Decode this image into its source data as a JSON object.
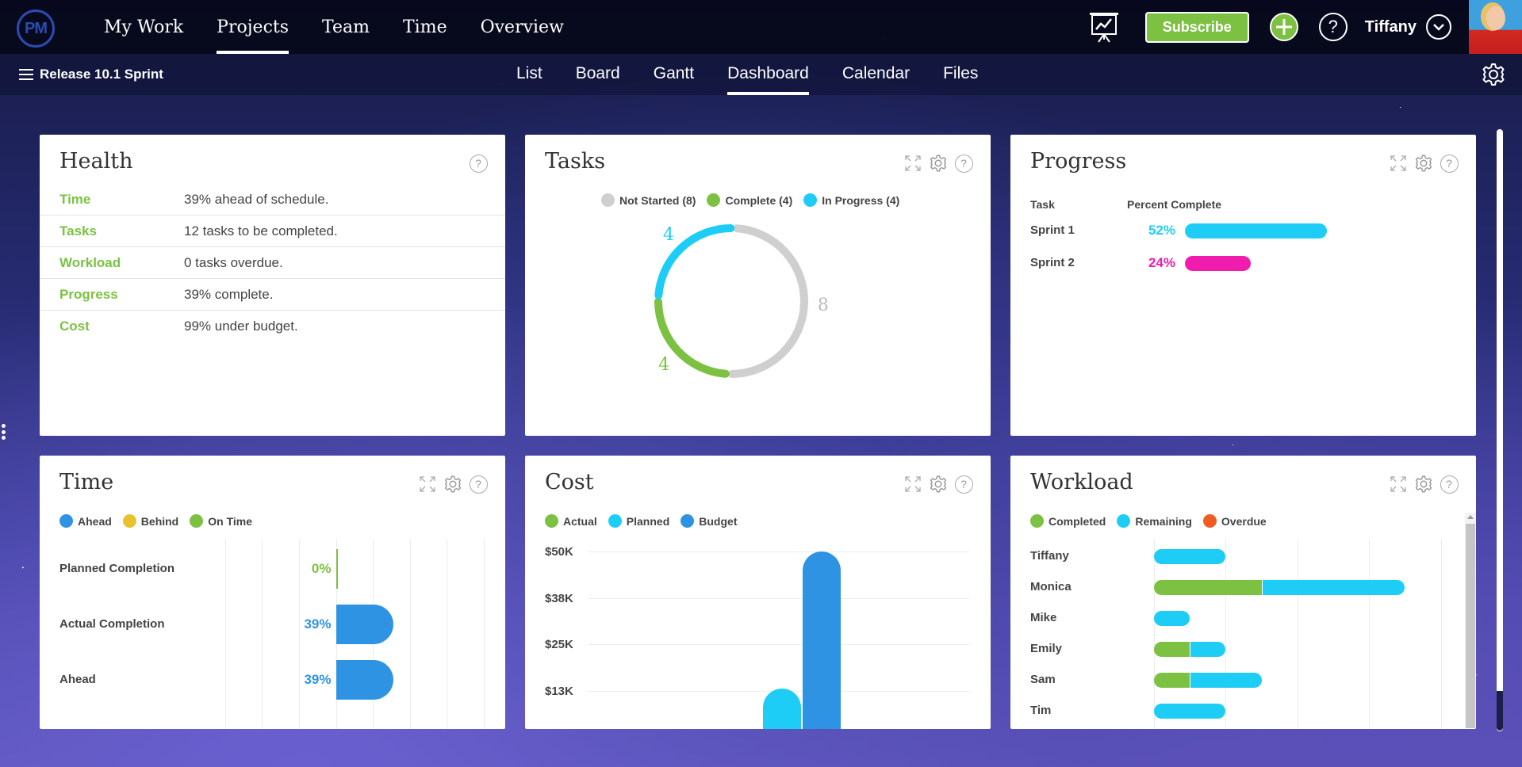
{
  "topnav": {
    "logo": "PM",
    "items": [
      {
        "label": "My Work",
        "active": false
      },
      {
        "label": "Projects",
        "active": true
      },
      {
        "label": "Team",
        "active": false
      },
      {
        "label": "Time",
        "active": false
      },
      {
        "label": "Overview",
        "active": false
      }
    ],
    "subscribe_label": "Subscribe",
    "user_name": "Tiffany"
  },
  "subnav": {
    "project_name": "Release 10.1 Sprint",
    "items": [
      {
        "label": "List",
        "active": false
      },
      {
        "label": "Board",
        "active": false
      },
      {
        "label": "Gantt",
        "active": false
      },
      {
        "label": "Dashboard",
        "active": true
      },
      {
        "label": "Calendar",
        "active": false
      },
      {
        "label": "Files",
        "active": false
      }
    ]
  },
  "colors": {
    "green": "#7cc142",
    "cyan": "#1ecdf5",
    "blue": "#2f93e4",
    "magenta": "#f01cae",
    "gray": "#cfcfcf",
    "yellow": "#e8c22e",
    "orange": "#f05a23"
  },
  "health": {
    "title": "Health",
    "rows": [
      {
        "label": "Time",
        "value": "39% ahead of schedule."
      },
      {
        "label": "Tasks",
        "value": "12 tasks to be completed."
      },
      {
        "label": "Workload",
        "value": "0 tasks overdue."
      },
      {
        "label": "Progress",
        "value": "39% complete."
      },
      {
        "label": "Cost",
        "value": "99% under budget."
      }
    ]
  },
  "tasks": {
    "title": "Tasks",
    "legend": [
      "Not Started (8)",
      "Complete (4)",
      "In Progress (4)"
    ]
  },
  "progress": {
    "title": "Progress",
    "col_task": "Task",
    "col_percent": "Percent Complete"
  },
  "time": {
    "title": "Time",
    "legend": [
      "Ahead",
      "Behind",
      "On Time"
    ]
  },
  "cost": {
    "title": "Cost",
    "legend": [
      "Actual",
      "Planned",
      "Budget"
    ]
  },
  "workload": {
    "title": "Workload",
    "legend": [
      "Completed",
      "Remaining",
      "Overdue"
    ]
  },
  "chart_data": [
    {
      "id": "tasks",
      "type": "pie",
      "title": "Tasks",
      "variant": "donut",
      "slices": [
        {
          "name": "Not Started",
          "value": 8,
          "color": "#cfcfcf"
        },
        {
          "name": "Complete",
          "value": 4,
          "color": "#7cc142"
        },
        {
          "name": "In Progress",
          "value": 4,
          "color": "#1ecdf5"
        }
      ],
      "data_labels": [
        "8",
        "4",
        "4"
      ]
    },
    {
      "id": "progress",
      "type": "bar",
      "orientation": "horizontal",
      "title": "Progress",
      "categories": [
        "Sprint 1",
        "Sprint 2"
      ],
      "values": [
        52,
        24
      ],
      "value_labels": [
        "52%",
        "24%"
      ],
      "colors": [
        "#1ecdf5",
        "#f01cae"
      ],
      "xlim": [
        0,
        100
      ]
    },
    {
      "id": "time",
      "type": "bar",
      "orientation": "horizontal",
      "title": "Time",
      "categories": [
        "Planned Completion",
        "Actual Completion",
        "Ahead"
      ],
      "values": [
        0,
        39,
        39
      ],
      "value_labels": [
        "0%",
        "39%",
        "39%"
      ],
      "colors": [
        "#7cc142",
        "#2f93e4",
        "#2f93e4"
      ],
      "xlim": [
        -100,
        100
      ],
      "grid": true,
      "legend": [
        "Ahead",
        "Behind",
        "On Time"
      ]
    },
    {
      "id": "cost",
      "type": "bar",
      "title": "Cost",
      "series": [
        {
          "name": "Actual",
          "values": [
            0
          ],
          "color": "#7cc142"
        },
        {
          "name": "Planned",
          "values": [
            13000
          ],
          "color": "#1ecdf5"
        },
        {
          "name": "Budget",
          "values": [
            50000
          ],
          "color": "#2f93e4"
        }
      ],
      "categories": [
        ""
      ],
      "yticks": [
        "$50K",
        "$38K",
        "$25K",
        "$13K"
      ],
      "ytick_values": [
        50000,
        37500,
        25000,
        12500
      ],
      "ylim": [
        0,
        50000
      ],
      "grid": true
    },
    {
      "id": "workload",
      "type": "bar",
      "orientation": "horizontal",
      "stacked": true,
      "title": "Workload",
      "categories": [
        "Tiffany",
        "Monica",
        "Mike",
        "Emily",
        "Sam",
        "Tim"
      ],
      "series": [
        {
          "name": "Completed",
          "values": [
            0,
            3,
            0,
            1,
            1,
            0
          ],
          "color": "#7cc142"
        },
        {
          "name": "Remaining",
          "values": [
            2,
            4,
            1,
            1,
            2,
            2
          ],
          "color": "#1ecdf5"
        },
        {
          "name": "Overdue",
          "values": [
            0,
            0,
            0,
            0,
            0,
            0
          ],
          "color": "#f05a23"
        }
      ],
      "xlim": [
        0,
        8
      ],
      "grid": true
    }
  ]
}
